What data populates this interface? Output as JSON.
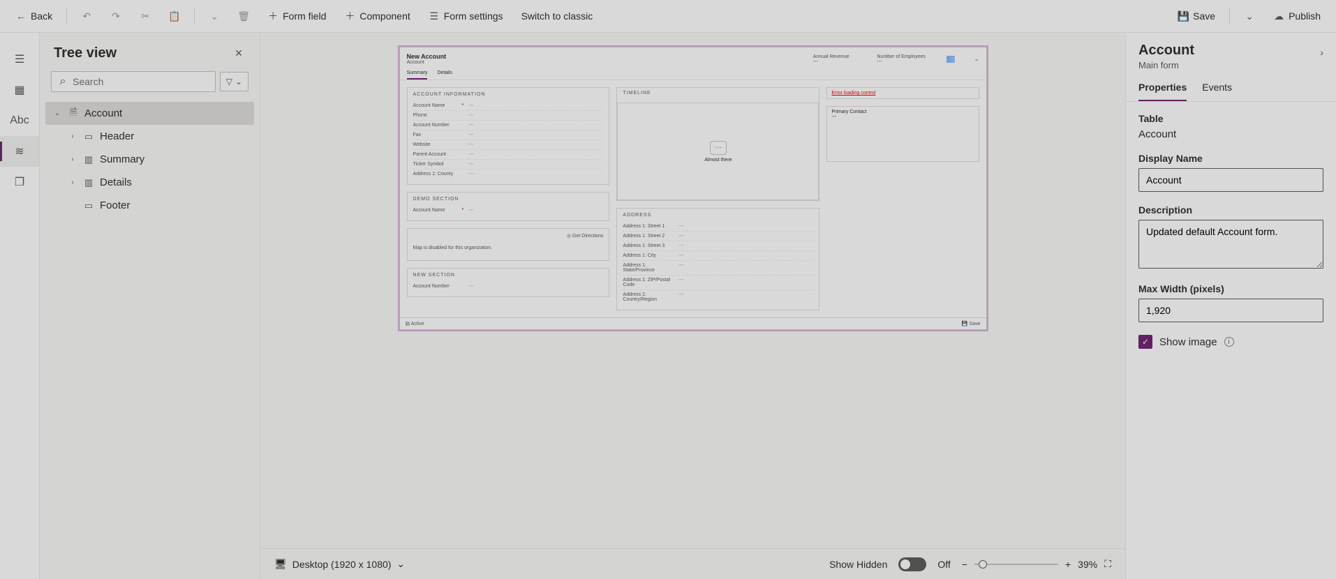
{
  "topbar": {
    "back": "Back",
    "form_field": "Form field",
    "component": "Component",
    "form_settings": "Form settings",
    "switch_classic": "Switch to classic",
    "save": "Save",
    "publish": "Publish"
  },
  "tree": {
    "title": "Tree view",
    "search_placeholder": "Search",
    "items": {
      "root": "Account",
      "header": "Header",
      "summary": "Summary",
      "details": "Details",
      "footer": "Footer"
    }
  },
  "canvas": {
    "header": {
      "title": "New Account",
      "subtitle": "Account",
      "fields": {
        "f1": "Annual Revenue",
        "f2": "Number of Employees"
      },
      "val_placeholder": "---"
    },
    "tabs": {
      "summary": "Summary",
      "details": "Details"
    },
    "sections": {
      "account_info": {
        "title": "ACCOUNT INFORMATION",
        "fields": {
          "account_name": "Account Name",
          "phone": "Phone",
          "account_number": "Account Number",
          "fax": "Fax",
          "website": "Website",
          "parent_account": "Parent Account",
          "ticker_symbol": "Ticker Symbol",
          "address1_county": "Address 1: County"
        }
      },
      "demo": {
        "title": "Demo Section",
        "fields": {
          "account_name": "Account Name"
        }
      },
      "map": {
        "get_directions": "Get Directions",
        "note": "Map is disabled for this organization."
      },
      "new_section": {
        "title": "New Section",
        "fields": {
          "account_number": "Account Number"
        }
      },
      "timeline": {
        "title": "Timeline",
        "msg": "Almost there"
      },
      "address": {
        "title": "ADDRESS",
        "fields": {
          "street1": "Address 1: Street 1",
          "street2": "Address 1: Street 2",
          "street3": "Address 1: Street 3",
          "city": "Address 1: City",
          "state": "Address 1: State/Province",
          "zip": "Address 1: ZIP/Postal Code",
          "country": "Address 1: Country/Region"
        }
      },
      "error": "Error loading control",
      "primary_contact": "Primary Contact"
    },
    "footer": {
      "active": "Active",
      "save": "Save"
    }
  },
  "bottombar": {
    "viewport": "Desktop (1920 x 1080)",
    "show_hidden": "Show Hidden",
    "hidden_state": "Off",
    "zoom_pct": "39%"
  },
  "props": {
    "title": "Account",
    "subtitle": "Main form",
    "tabs": {
      "properties": "Properties",
      "events": "Events"
    },
    "table_label": "Table",
    "table_value": "Account",
    "display_name_label": "Display Name",
    "display_name_value": "Account",
    "description_label": "Description",
    "description_value": "Updated default Account form.",
    "max_width_label": "Max Width (pixels)",
    "max_width_value": "1,920",
    "show_image_label": "Show image",
    "zoom_minus": "−",
    "zoom_plus": "+"
  }
}
